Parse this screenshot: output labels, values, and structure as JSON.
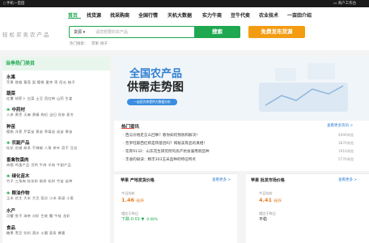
{
  "topbar": {
    "mobile": "手机一亩田",
    "merchant": "商户工作台"
  },
  "nav": {
    "items": [
      "首页",
      "找货源",
      "找采购商",
      "全国行情",
      "天机大数据",
      "实力牛商",
      "豆牛代卖",
      "农业技术",
      "一亩田介绍"
    ]
  },
  "logo": "轻松买卖农产品",
  "search": {
    "category": "货源",
    "placeholder": "请您想要的农产品",
    "button": "搜索"
  },
  "publish_button": "免费发布货源",
  "hot_search": {
    "label": "热门搜索：",
    "items": [
      "苹果",
      "桃子"
    ]
  },
  "sidebar": {
    "title": "当季热门类目",
    "categories": [
      {
        "name": "水果",
        "subs": "苹果  猕猴  葡萄  梨  樱桃  蜜李  枣  西瓜  柚子"
      },
      {
        "name": "蔬菜",
        "subs": "红薯  胡萝卜  白菜  土豆  西红柿  山药  生姜"
      },
      {
        "name": "中药材",
        "subs": "人参  黄芪  天麻  黄精  枸杞  当归  党参  麦冬"
      },
      {
        "name": "种苗",
        "subs": "樱桃  洋葱  芹菜苗  黄苗  草莓苗  苗苗  果苗"
      },
      {
        "name": "农副产品",
        "subs": "桂花  花椒  粉条  干辣椒  八角  茶叶  蒜干  豆丝"
      },
      {
        "name": "畜禽牧蛋肉",
        "subs": "肉鹅  鸡蛋产品  活鸡  牛肉  羊肉  牛副产品"
      },
      {
        "name": "绿化苗木",
        "subs": "竹子  三角梅  桂花树  枫树  松树  竹苗  苗种"
      },
      {
        "name": "粮油作物",
        "subs": "玉米  花生  大米  大豆  稻谷  小米  高粱  小麦"
      },
      {
        "name": "水产",
        "subs": "河蟹  鱼干  海带  对虾  生蚝  蟹  牛蛙  龙虾"
      },
      {
        "name": "食品",
        "subs": "糖果  黑豆  饮料  酒水  火腿  面条  蜂蜜"
      }
    ]
  },
  "banner": {
    "title1": "全国农产品",
    "title2": "供需走势图",
    "pill": "一亩田为你提供大数据分析"
  },
  "hot_info": {
    "title": "热门资讯",
    "more": "查看更多资讯 >",
    "items": [
      {
        "text": "西瓜价格走怎么回事？教你如何预防和解决！",
        "count": "4000浏览"
      },
      {
        "text": "普罗旺斯西红柿是转基因吗？揭秘美育品的真相！",
        "count": "3870浏览"
      },
      {
        "text": "花育9132：山东花生研究所的高产抗食兼用新品种",
        "count": "1910浏览"
      },
      {
        "text": "丰收的秘诀：精丰303玉米品种的特征特点",
        "count": "5770浏览"
      }
    ]
  },
  "origin_card": {
    "title": "苹果 产地发货价格",
    "more": "查看更多 >",
    "today_label": "今日均价",
    "price": "1.46",
    "unit": "元/斤",
    "compare_label": "相比于昨日",
    "change": "下跌-0.01",
    "change_pct": "-0.68%"
  },
  "wholesale_card": {
    "title": "苹果 批发市场价格",
    "more": "查看更多 >",
    "today_label": "今日均价",
    "price": "4.41",
    "unit": "元/斤",
    "compare_label": "相比于昨日",
    "change": "平稳"
  },
  "colors": {
    "brand": "#1fa84f",
    "accent": "#f39c12",
    "link": "#2f7fd1",
    "down": "#1fa84f",
    "price": "#e67e22"
  }
}
